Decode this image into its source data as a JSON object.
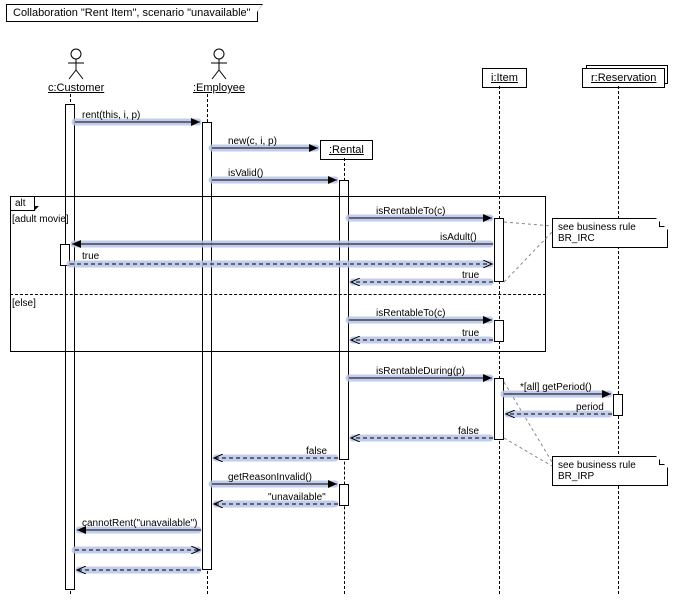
{
  "title": "Collaboration \"Rent Item\", scenario \"unavailable\"",
  "participants": {
    "customer": "c:Customer",
    "employee": ":Employee",
    "rental": ":Rental",
    "item": "i:Item",
    "reservation": "r:Reservation"
  },
  "messages": {
    "m1": "rent(this, i, p)",
    "m2": "new(c, i, p)",
    "m3": "isValid()",
    "m4": "isRentableTo(c)",
    "m5": "isAdult()",
    "m6": "true",
    "m7": "true",
    "m8": "isRentableTo(c)",
    "m9": "true",
    "m10": "isRentableDuring(p)",
    "m11": "*[all] getPeriod()",
    "m12": "period",
    "m13": "false",
    "m14": "false",
    "m15": "getReasonInvalid()",
    "m16": "\"unavailable\"",
    "m17": "cannotRent(\"unavailable\")"
  },
  "frame": {
    "alt": "alt",
    "guard1": "[adult movie]",
    "guard2": "[else]"
  },
  "notes": {
    "n1": "see business rule BR_IRC",
    "n2": "see business rule BR_IRP"
  },
  "chart_data": {
    "type": "sequence-diagram",
    "title": "Collaboration \"Rent Item\", scenario \"unavailable\"",
    "participants": [
      {
        "id": "c",
        "name": "c:Customer",
        "kind": "actor"
      },
      {
        "id": "e",
        "name": ":Employee",
        "kind": "actor"
      },
      {
        "id": "rn",
        "name": ":Rental",
        "kind": "object",
        "created": true
      },
      {
        "id": "i",
        "name": "i:Item",
        "kind": "object"
      },
      {
        "id": "r",
        "name": "r:Reservation",
        "kind": "object",
        "multi": true
      }
    ],
    "messages": [
      {
        "from": "c",
        "to": "e",
        "label": "rent(this, i, p)",
        "type": "sync"
      },
      {
        "from": "e",
        "to": "rn",
        "label": "new(c, i, p)",
        "type": "create"
      },
      {
        "from": "e",
        "to": "rn",
        "label": "isValid()",
        "type": "sync"
      },
      {
        "frame": "alt",
        "sections": [
          {
            "guard": "[adult movie]",
            "messages": [
              {
                "from": "rn",
                "to": "i",
                "label": "isRentableTo(c)",
                "type": "sync",
                "note": "see business rule BR_IRC"
              },
              {
                "from": "i",
                "to": "c",
                "label": "isAdult()",
                "type": "sync"
              },
              {
                "from": "c",
                "to": "i",
                "label": "true",
                "type": "return"
              },
              {
                "from": "i",
                "to": "rn",
                "label": "true",
                "type": "return"
              }
            ]
          },
          {
            "guard": "[else]",
            "messages": [
              {
                "from": "rn",
                "to": "i",
                "label": "isRentableTo(c)",
                "type": "sync"
              },
              {
                "from": "i",
                "to": "rn",
                "label": "true",
                "type": "return"
              }
            ]
          }
        ]
      },
      {
        "from": "rn",
        "to": "i",
        "label": "isRentableDuring(p)",
        "type": "sync",
        "note": "see business rule BR_IRP"
      },
      {
        "from": "i",
        "to": "r",
        "label": "*[all] getPeriod()",
        "type": "sync"
      },
      {
        "from": "r",
        "to": "i",
        "label": "period",
        "type": "return"
      },
      {
        "from": "i",
        "to": "rn",
        "label": "false",
        "type": "return"
      },
      {
        "from": "rn",
        "to": "e",
        "label": "false",
        "type": "return"
      },
      {
        "from": "e",
        "to": "rn",
        "label": "getReasonInvalid()",
        "type": "sync"
      },
      {
        "from": "rn",
        "to": "e",
        "label": "\"unavailable\"",
        "type": "return"
      },
      {
        "from": "e",
        "to": "c",
        "label": "cannotRent(\"unavailable\")",
        "type": "sync"
      },
      {
        "from": "c",
        "to": "e",
        "label": "",
        "type": "return"
      },
      {
        "from": "e",
        "to": "c",
        "label": "",
        "type": "return"
      }
    ]
  }
}
